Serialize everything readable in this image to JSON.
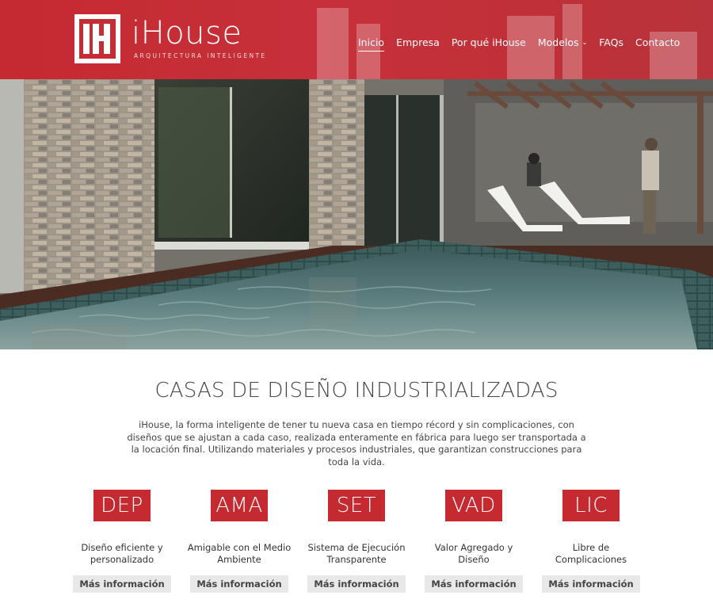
{
  "brand": {
    "name": "iHouse",
    "tagline": "ARQUITECTURA INTELIGENTE",
    "primary_color": "#c42a30"
  },
  "nav": {
    "items": [
      {
        "label": "Inicio",
        "active": true
      },
      {
        "label": "Empresa"
      },
      {
        "label": "Por qué iHouse"
      },
      {
        "label": "Modelos",
        "has_dropdown": true
      },
      {
        "label": "FAQs"
      },
      {
        "label": "Contacto"
      }
    ]
  },
  "main": {
    "headline": "CASAS DE DISEÑO INDUSTRIALIZADAS",
    "intro": "iHouse, la forma inteligente de tener tu nueva casa en tiempo récord y sin complicaciones, con diseños que se ajustan a cada caso, realizada enteramente en fábrica para luego ser transportada a la locación final. Utilizando materiales y procesos industriales, que garantizan construcciones para toda la vida.",
    "features": [
      {
        "code": "DEP",
        "description": "Diseño eficiente y personalizado",
        "button": "Más información"
      },
      {
        "code": "AMA",
        "description": "Amigable con el Medio Ambiente",
        "button": "Más información"
      },
      {
        "code": "SET",
        "description": "Sistema de Ejecución Transparente",
        "button": "Más información"
      },
      {
        "code": "VAD",
        "description": "Valor Agregado y Diseño",
        "button": "Más información"
      },
      {
        "code": "LIC",
        "description": "Libre de Complicaciones",
        "button": "Más información"
      }
    ]
  }
}
